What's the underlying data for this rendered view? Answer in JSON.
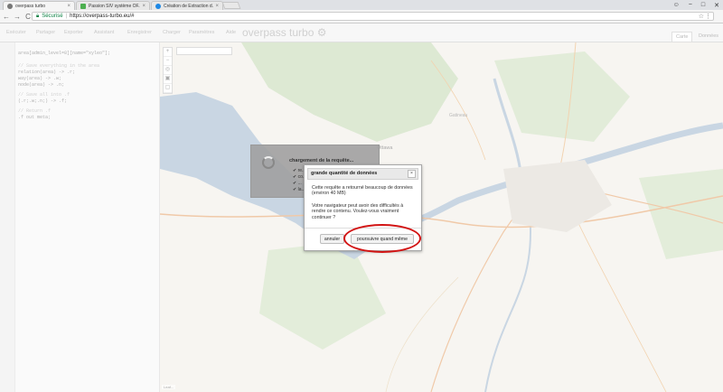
{
  "browser": {
    "tabs": [
      {
        "label": "overpass turbo",
        "close": "×",
        "active": true,
        "icon_color": "#777777"
      },
      {
        "label": "Passion SIV système OF...",
        "close": "×",
        "active": false,
        "icon_color": "#4caf50"
      },
      {
        "label": "Création de Extraction d...",
        "close": "×",
        "active": false,
        "icon_color": "#1e88e5"
      }
    ],
    "window_controls": {
      "profile": "☺",
      "minimize": "−",
      "maximize": "□",
      "close": "✕"
    },
    "nav": {
      "back": "←",
      "forward": "→",
      "reload": "C"
    },
    "address": {
      "secure_label": "Sécurisé",
      "separator": "|",
      "url": "https://overpass-turbo.eu/#",
      "star": "☆",
      "menu": "⋮"
    }
  },
  "toolbar": {
    "buttons": [
      "Exécuter",
      "Partager",
      "Exporter",
      "Assistant",
      "Enregistrer",
      "Charger",
      "Paramètres",
      "Aide"
    ],
    "app_title": "overpass turbo ⚙",
    "view_tabs": [
      {
        "label": "Carte",
        "active": true
      },
      {
        "label": "Données",
        "active": false
      }
    ]
  },
  "editor": {
    "lines": [
      "area[admin_level=8][name=\"xyleo\"];",
      "",
      "// Save everything in the area",
      "relation(area) -> .r;",
      "way(area) -> .w;",
      "node(area) -> .n;",
      "",
      "// Save all into .f",
      "(.r;.w;.n;) -> .f;",
      "",
      "// Return .f",
      ".f out meta;"
    ]
  },
  "map": {
    "cities": [
      {
        "name": "Ottawa",
        "major": true
      },
      {
        "name": "Gatineau",
        "major": false
      }
    ],
    "zoom": {
      "in": "+",
      "out": "−"
    },
    "attribution": "Leaf..."
  },
  "loading": {
    "title": "chargement de la requête...",
    "steps": [
      "✔ re...",
      "✔ co...",
      "✔ ...",
      "✔ la..."
    ]
  },
  "dialog": {
    "title": "grande quantité de données",
    "close": "×",
    "paragraph1": "Cette requête a retourné beaucoup de données (environ 40 MB)",
    "paragraph2": "Votre navigateur peut avoir des difficultés à rendre ce contenu. Voulez-vous vraiment continuer ?",
    "cancel_label": "annuler",
    "continue_label": "poursuivre quand même"
  },
  "colors": {
    "secure_green": "#0b8043",
    "highlight_red": "#d21414",
    "water": "#c9d6e3",
    "park": "#d8e7cf"
  }
}
